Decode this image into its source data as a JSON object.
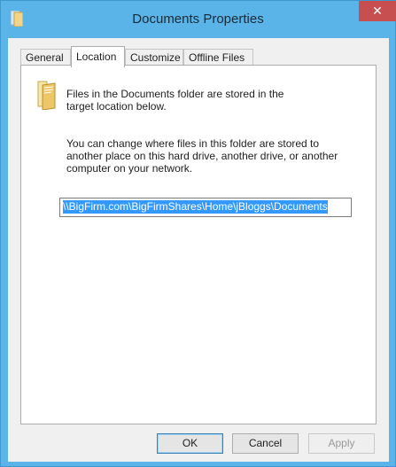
{
  "window": {
    "title": "Documents Properties",
    "close_symbol": "✕"
  },
  "tabs": [
    {
      "label": "General",
      "active": false
    },
    {
      "label": "Location",
      "active": true
    },
    {
      "label": "Customize",
      "active": false
    },
    {
      "label": "Offline Files",
      "active": false
    }
  ],
  "location": {
    "intro_line1": "Files in the Documents folder are stored in the",
    "intro_line2": "target location below.",
    "change_line1": "You can change where files in this folder are stored to",
    "change_line2": "another place on this hard drive, another drive, or another",
    "change_line3": "computer on your network.",
    "path_value": "\\\\BigFirm.com\\BigFirmShares\\Home\\jBloggs\\Documents"
  },
  "buttons": {
    "ok": "OK",
    "cancel": "Cancel",
    "apply": "Apply"
  },
  "icons": {
    "app": "folder-app-icon",
    "folder": "documents-folder-icon",
    "close": "close-icon"
  },
  "colors": {
    "titlebar": "#5ab4e8",
    "close": "#c74f50",
    "selection": "#3399ff"
  }
}
